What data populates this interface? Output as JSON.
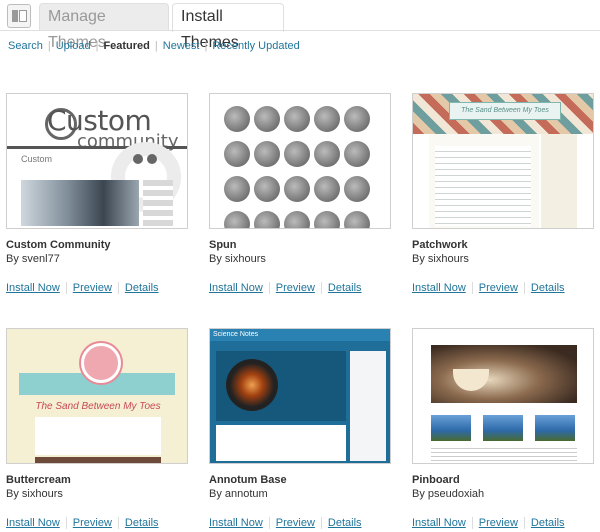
{
  "header": {
    "tabs": [
      {
        "label": "Manage Themes",
        "active": false
      },
      {
        "label": "Install Themes",
        "active": true
      }
    ]
  },
  "subnav": {
    "items": [
      {
        "label": "Search",
        "current": false
      },
      {
        "label": "Upload",
        "current": false
      },
      {
        "label": "Featured",
        "current": true
      },
      {
        "label": "Newest",
        "current": false
      },
      {
        "label": "Recently Updated",
        "current": false
      }
    ]
  },
  "actions": {
    "install": "Install Now",
    "preview": "Preview",
    "details": "Details"
  },
  "themes": [
    {
      "name": "Custom Community",
      "author": "By svenl77",
      "thumb": {
        "logo_big": "Custom",
        "logo_small": "community",
        "mini_logo": "Custom"
      }
    },
    {
      "name": "Spun",
      "author": "By sixhours"
    },
    {
      "name": "Patchwork",
      "author": "By sixhours",
      "thumb": {
        "banner": "The Sand Between My Toes"
      }
    },
    {
      "name": "Buttercream",
      "author": "By sixhours",
      "thumb": {
        "title": "The Sand Between My Toes"
      }
    },
    {
      "name": "Annotum Base",
      "author": "By annotum",
      "thumb": {
        "header": "Science Notes"
      }
    },
    {
      "name": "Pinboard",
      "author": "By pseudoxiah"
    }
  ],
  "colors": {
    "link": "#21759b",
    "border": "#dfdfdf",
    "inactive_tab": "#ececec"
  }
}
